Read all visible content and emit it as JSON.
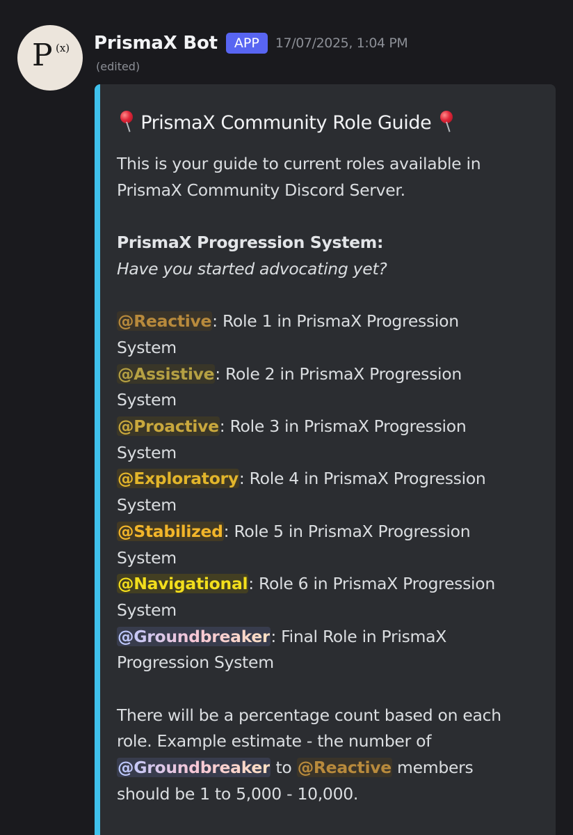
{
  "message": {
    "avatar": {
      "letter": "P",
      "superscript": "(x)"
    },
    "username": "PrismaX Bot",
    "badge": "APP",
    "timestamp": "17/07/2025, 1:04 PM",
    "edited": "(edited)"
  },
  "embed": {
    "accent_color": "#3fc1ec",
    "title": "PrismaX Community Role Guide",
    "title_icon": "round-pushpin-icon",
    "intro": [
      "This is your guide to current roles available in",
      "PrismaX Community Discord Server."
    ],
    "section_heading": "PrismaX Progression System:",
    "section_subheading": "Have you started advocating yet?",
    "roles": [
      {
        "mention": "@Reactive",
        "color": "#b88a3c",
        "bg": "#3a3429",
        "line1": ": Role 1 in PrismaX Progression",
        "line2": "System"
      },
      {
        "mention": "@Assistive",
        "color": "#b5a043",
        "bg": "#393628",
        "line1": ": Role 2 in PrismaX Progression",
        "line2": "System"
      },
      {
        "mention": "@Proactive",
        "color": "#c9a83d",
        "bg": "#3b3727",
        "line1": ": Role 3 in PrismaX Progression",
        "line2": "System"
      },
      {
        "mention": "@Exploratory",
        "color": "#e2b52b",
        "bg": "#403925",
        "line1": ": Role 4 in PrismaX Progression",
        "line2": "System"
      },
      {
        "mention": "@Stabilized",
        "color": "#f2b52a",
        "bg": "#433a24",
        "line1": ": Role 5 in PrismaX Progression",
        "line2": "System"
      },
      {
        "mention": "@Navigational",
        "color": "#f3de1c",
        "bg": "#433f22",
        "line1": ": Role 6 in PrismaX Progression",
        "line2": "System"
      },
      {
        "mention": "@Groundbreaker",
        "gradient": [
          "#b8c8ff",
          "#f6c6d6",
          "#ffe1c4"
        ],
        "bg": "#383c4d",
        "line1": ": Final Role in PrismaX",
        "line2": "Progression System"
      }
    ],
    "footer": {
      "line1": "There will be a percentage count based on each",
      "line2": "role. Example estimate - the number of",
      "mention_a": "@Groundbreaker",
      "connector": " to ",
      "mention_b": "@Reactive",
      "line3_tail": " members",
      "line4": "should be 1 to 5,000 - 10,000."
    }
  }
}
